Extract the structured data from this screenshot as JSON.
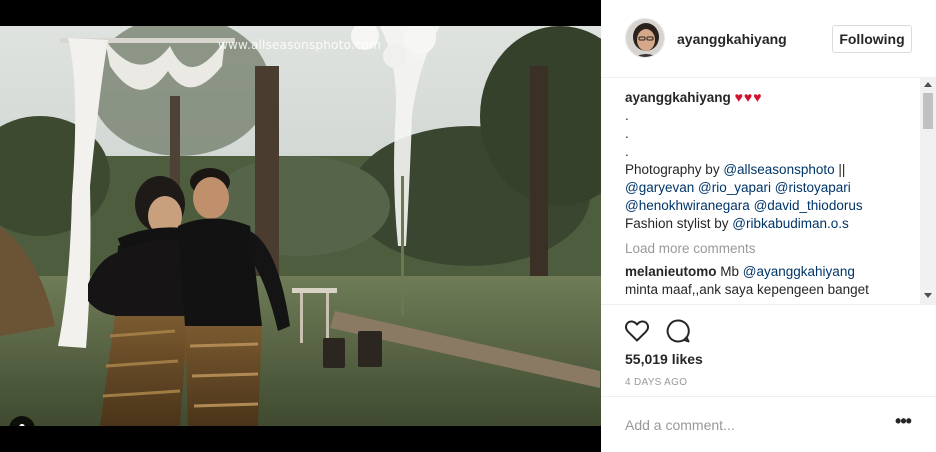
{
  "post": {
    "watermark": "www.allseasonsphoto.com",
    "author": {
      "username": "ayanggkahiyang",
      "follow_label": "Following"
    },
    "caption": {
      "username": "ayanggkahiyang",
      "hearts": "♥♥♥",
      "dots": [
        ".",
        ".",
        "."
      ],
      "photography_prefix": "Photography by ",
      "photographer": "@allseasonsphoto",
      "separator": " ||",
      "credits": [
        "@garyevan",
        "@rio_yapari",
        "@ristoyapari",
        "@henokhwiranegara",
        "@david_thiodorus"
      ],
      "stylist_prefix": "Fashion stylist by ",
      "stylist": "@ribkabudiman.o.s"
    },
    "load_more_label": "Load more comments",
    "comment": {
      "username": "melanieutomo",
      "prefix": "Mb ",
      "mention": "@ayanggkahiyang",
      "line2": "minta maaf,,ank saya kepengeen banget"
    },
    "likes": "55,019 likes",
    "time_ago": "4 DAYS AGO",
    "add_comment_placeholder": "Add a comment...",
    "more_label": "•••",
    "icons": {
      "like": "heart-icon",
      "comment": "speech-bubble-icon",
      "user_tag": "user-tag-icon"
    },
    "colors": {
      "link": "#003569",
      "hearts": "#d3122e",
      "muted": "#999999"
    }
  }
}
